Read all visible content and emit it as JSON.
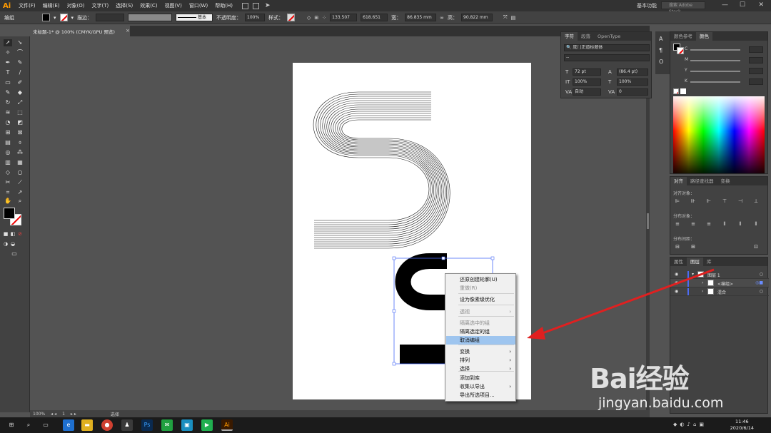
{
  "app": {
    "logo": "Ai",
    "menus": [
      "文件(F)",
      "编辑(E)",
      "对象(O)",
      "文字(T)",
      "选择(S)",
      "效果(C)",
      "视图(V)",
      "窗口(W)",
      "帮助(H)"
    ],
    "workspace": "基本功能",
    "search_placeholder": "搜索 Adobe Stock",
    "window_controls": [
      "—",
      "☐",
      "✕"
    ]
  },
  "control_bar": {
    "selection_label": "编组",
    "stroke_label": "描边：",
    "stroke_style": "基本",
    "opacity_label": "不透明度：",
    "opacity_value": "100%",
    "style_label": "样式：",
    "x_value": "133.507",
    "y_value": "618.651",
    "w_label": "宽：",
    "w_value": "86.835 mm",
    "h_label": "高：",
    "h_value": "90.822 mm"
  },
  "document": {
    "tab_title": "未标题-1* @ 100% (CMYK/GPU 预览)",
    "close": "×"
  },
  "status_bar": {
    "zoom": "100%",
    "page": "1",
    "tool": "选择"
  },
  "character_panel": {
    "tabs": [
      "字符",
      "段落",
      "OpenType"
    ],
    "font": "庞门正道标题体",
    "font_style": "--",
    "size": "72 pt",
    "leading": "(86.4 pt)",
    "v_scale": "100%",
    "h_scale": "100%",
    "kerning": "自动",
    "tracking": "0"
  },
  "color_panel": {
    "tabs": [
      "颜色参考",
      "颜色"
    ],
    "channels": [
      "C",
      "M",
      "Y",
      "K"
    ]
  },
  "align_panel": {
    "tabs": [
      "对齐",
      "路径查找器",
      "变换"
    ],
    "section_align": "对齐对象：",
    "section_distribute": "分布对象：",
    "section_spacing": "分布间距："
  },
  "layers_panel": {
    "tabs": [
      "属性",
      "图层",
      "库"
    ],
    "rows": [
      {
        "name": "图层 1"
      },
      {
        "name": "<编组>"
      },
      {
        "name": "混合"
      }
    ]
  },
  "context_menu": {
    "items": [
      {
        "label": "还原创建轮廓(U)",
        "disabled": false,
        "submenu": false
      },
      {
        "label": "重做(R)",
        "disabled": true,
        "submenu": false
      },
      {
        "label": "设为像素级优化",
        "disabled": false,
        "submenu": false
      },
      {
        "label": "透视",
        "disabled": true,
        "submenu": true
      },
      {
        "label": "隔离选中的组",
        "disabled": true,
        "submenu": false
      },
      {
        "label": "隔离选定的组",
        "disabled": false,
        "submenu": false
      },
      {
        "label": "取消编组",
        "disabled": false,
        "submenu": false,
        "highlighted": true
      },
      {
        "label": "变换",
        "disabled": false,
        "submenu": true
      },
      {
        "label": "排列",
        "disabled": false,
        "submenu": true
      },
      {
        "label": "选择",
        "disabled": false,
        "submenu": true
      },
      {
        "label": "添加到库",
        "disabled": false,
        "submenu": false
      },
      {
        "label": "收集以导出",
        "disabled": false,
        "submenu": true
      },
      {
        "label": "导出所选项目...",
        "disabled": false,
        "submenu": false
      }
    ]
  },
  "taskbar": {
    "time": "11:46",
    "date": "2020/6/14"
  },
  "watermark": {
    "brand": "Bai经验",
    "url": "jingyan.baidu.com"
  },
  "colors": {
    "accent_orange": "#ff9a00",
    "highlight_blue": "#9ec5ef",
    "arrow_red": "#e02020"
  }
}
